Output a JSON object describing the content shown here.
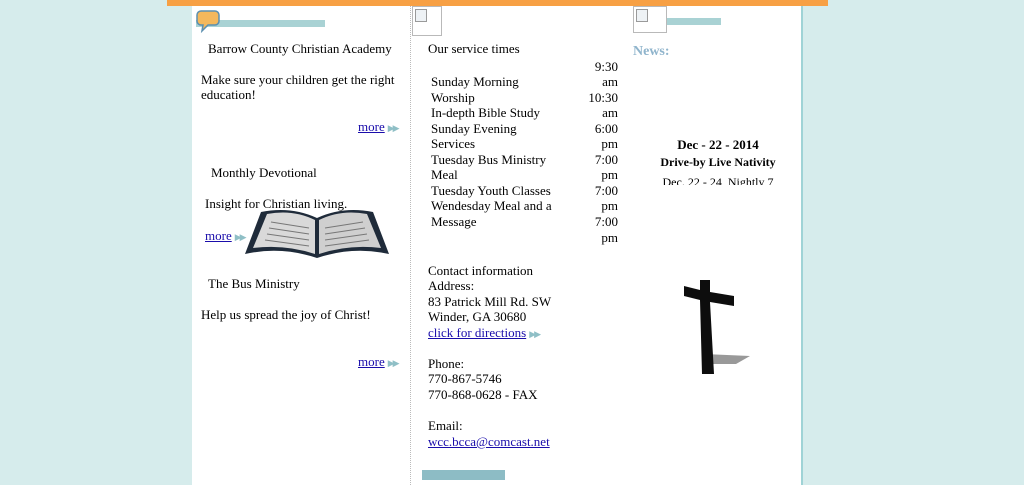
{
  "left": {
    "academy": {
      "title": "Barrow County Christian Academy",
      "desc": "Make sure your children get the right education!",
      "more": "more"
    },
    "devotional": {
      "title": "Monthly Devotional",
      "desc": "Insight for Christian living.",
      "more": "more"
    },
    "bus": {
      "title": "The Bus Ministry",
      "desc": "Help us spread the joy of Christ!",
      "more": "more"
    }
  },
  "middle": {
    "service_title": "Our service times",
    "services": [
      {
        "name": "Sunday Morning",
        "name2": "Worship",
        "time": "9:30",
        "ampm": "am"
      },
      {
        "name": "In-depth Bible Study",
        "time": "10:30",
        "ampm": "am"
      },
      {
        "name": "Sunday Evening",
        "name2": "Services",
        "time": "6:00",
        "ampm": "pm"
      },
      {
        "name": "Tuesday Bus Ministry",
        "name2": "Meal",
        "time": "7:00",
        "ampm": "pm"
      },
      {
        "name": "Tuesday Youth Classes",
        "time": "7:00",
        "ampm": "pm"
      },
      {
        "name": "Wendesday Meal and a",
        "name2": "Message",
        "time": "7:00",
        "ampm": "pm"
      }
    ],
    "contact_title": "Contact information",
    "address_label": "Address:",
    "address_line1": "83 Patrick Mill Rd. SW",
    "address_line2": "Winder, GA 30680",
    "directions": "click for directions",
    "phone_label": "Phone:",
    "phone": "770-867-5746",
    "fax": "770-868-0628 - FAX",
    "email_label": "Email:",
    "email": "wcc.bcca@comcast.net"
  },
  "right": {
    "news_title": "News:",
    "news_date": "Dec - 22 - 2014",
    "news_headline": "Drive-by Live Nativity",
    "news_scroll": "Dec. 22 - 24, Nightly 7"
  },
  "icons": {
    "chat": "speech-bubble-icon",
    "arrow": "double-chevron-right-icon",
    "bible": "open-bible-icon",
    "cross": "cross-icon"
  },
  "colors": {
    "accent_orange": "#f7a044",
    "teal_bar": "#a9d2d4",
    "news_blue": "#8fb4cc",
    "background": "#d6ecec",
    "link": "#1a0dab"
  }
}
